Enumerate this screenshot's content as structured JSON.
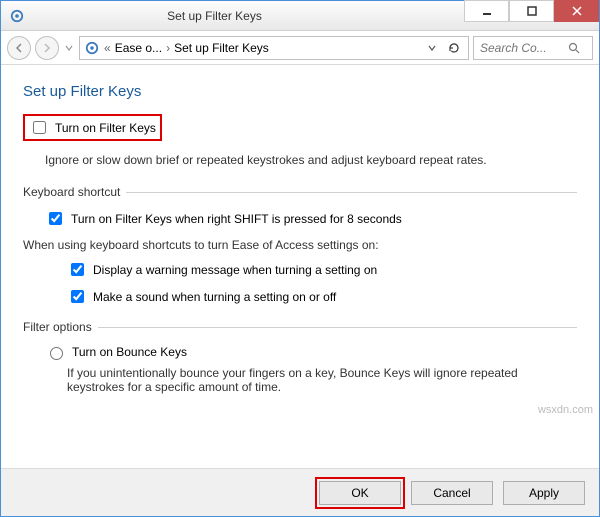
{
  "window": {
    "title": "Set up Filter Keys"
  },
  "breadcrumb": {
    "root_label": "Ease o...",
    "current": "Set up Filter Keys"
  },
  "search": {
    "placeholder": "Search Co..."
  },
  "page": {
    "heading": "Set up Filter Keys",
    "turn_on_label": "Turn on Filter Keys",
    "turn_on_checked": false,
    "description": "Ignore or slow down brief or repeated keystrokes and adjust keyboard repeat rates."
  },
  "shortcut": {
    "legend": "Keyboard shortcut",
    "shift_label": "Turn on Filter Keys when right SHIFT is pressed for 8 seconds",
    "shift_checked": true,
    "subtext": "When using keyboard shortcuts to turn Ease of Access settings on:",
    "warn_label": "Display a warning message when turning a setting on",
    "warn_checked": true,
    "sound_label": "Make a sound when turning a setting on or off",
    "sound_checked": true
  },
  "filter_options": {
    "legend": "Filter options",
    "bounce_label": "Turn on Bounce Keys",
    "bounce_checked": false,
    "bounce_desc": "If you unintentionally bounce your fingers on a key, Bounce Keys will ignore repeated keystrokes for a specific amount of time."
  },
  "footer": {
    "ok": "OK",
    "cancel": "Cancel",
    "apply": "Apply"
  },
  "watermark": "wsxdn.com"
}
